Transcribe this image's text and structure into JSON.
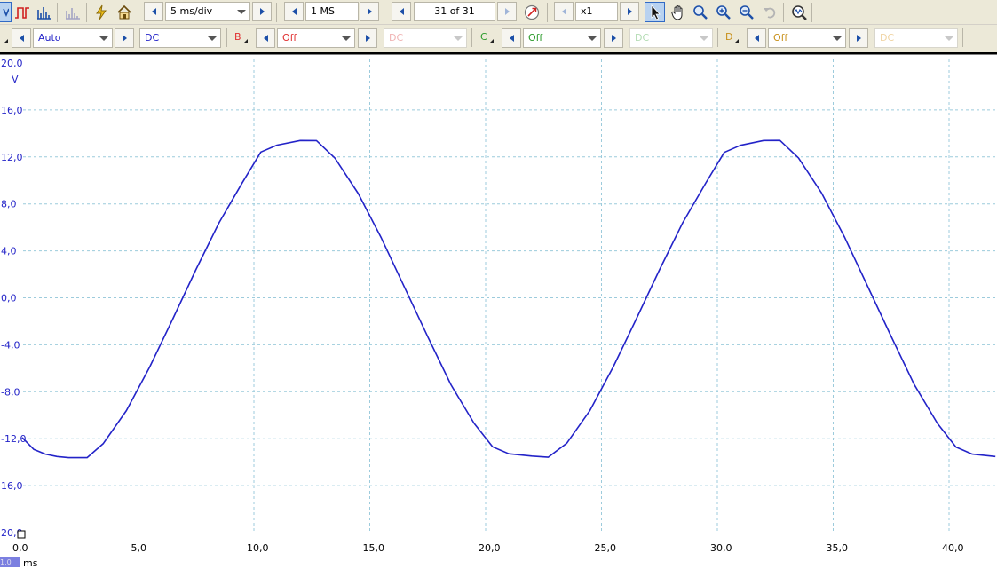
{
  "toolbar_top": {
    "timebase": "5 ms/div",
    "samples": "1 MS",
    "buffer": "31 of 31",
    "zoom": "x1"
  },
  "channels": {
    "a": {
      "label": "",
      "range": "Auto",
      "coupling": "DC",
      "color": "#2323c8"
    },
    "b": {
      "label": "B",
      "range": "Off",
      "coupling": "DC",
      "color": "#e03030"
    },
    "c": {
      "label": "C",
      "range": "Off",
      "coupling": "DC",
      "color": "#2a9a2a"
    },
    "d": {
      "label": "D",
      "range": "Off",
      "coupling": "DC",
      "color": "#c8901a"
    }
  },
  "icons": [
    "channel-a-icon",
    "square-wave-icon",
    "spectrum-icon",
    "persistence-icon",
    "auto-setup-icon",
    "home-icon",
    "signal-generator-icon",
    "pointer-icon",
    "hand-icon",
    "zoom-icon",
    "zoom-in-icon",
    "zoom-out-icon",
    "undo-zoom-icon",
    "zoom-overview-icon"
  ],
  "axis": {
    "unit": "V",
    "x_unit": "ms",
    "scale_badge": "1,0"
  },
  "chart_data": {
    "type": "line",
    "xlabel": "ms",
    "ylabel": "V",
    "xlim": [
      0,
      42
    ],
    "ylim": [
      -20,
      20
    ],
    "grid": true,
    "x_ticks": [
      "0,0",
      "5,0",
      "10,0",
      "15,0",
      "20,0",
      "25,0",
      "30,0",
      "35,0",
      "40,0"
    ],
    "y_ticks": [
      "20,0",
      "16,0",
      "12,0",
      "8,0",
      "4,0",
      "0,0",
      "-4,0",
      "-8,0",
      "-12,0",
      "16,0",
      "20,0"
    ],
    "series": [
      {
        "color": "#2323c8",
        "x": [
          0,
          0.5,
          1,
          1.5,
          2,
          2.8,
          3.5,
          4.5,
          5.5,
          6.5,
          7.5,
          8.5,
          9.5,
          10.3,
          11,
          12,
          12.7,
          13.5,
          14.5,
          15.5,
          16.5,
          17.5,
          18.5,
          19.5,
          20.3,
          21,
          22,
          22.7,
          23.5,
          24.5,
          25.5,
          26.5,
          27.5,
          28.5,
          29.5,
          30.3,
          31,
          32,
          32.7,
          33.5,
          34.5,
          35.5,
          36.5,
          37.5,
          38.5,
          39.5,
          40.3,
          41,
          42
        ],
        "y": [
          -11.9,
          -12.9,
          -13.3,
          -13.5,
          -13.6,
          -13.6,
          -12.4,
          -9.6,
          -5.9,
          -1.8,
          2.4,
          6.4,
          9.8,
          12.4,
          13.0,
          13.4,
          13.4,
          11.9,
          8.9,
          5.1,
          0.9,
          -3.3,
          -7.4,
          -10.7,
          -12.7,
          -13.3,
          -13.5,
          -13.6,
          -12.4,
          -9.6,
          -5.9,
          -1.8,
          2.4,
          6.4,
          9.8,
          12.4,
          13.0,
          13.4,
          13.4,
          11.9,
          8.9,
          5.1,
          0.9,
          -3.3,
          -7.4,
          -10.7,
          -12.7,
          -13.3,
          -13.5
        ]
      }
    ]
  }
}
